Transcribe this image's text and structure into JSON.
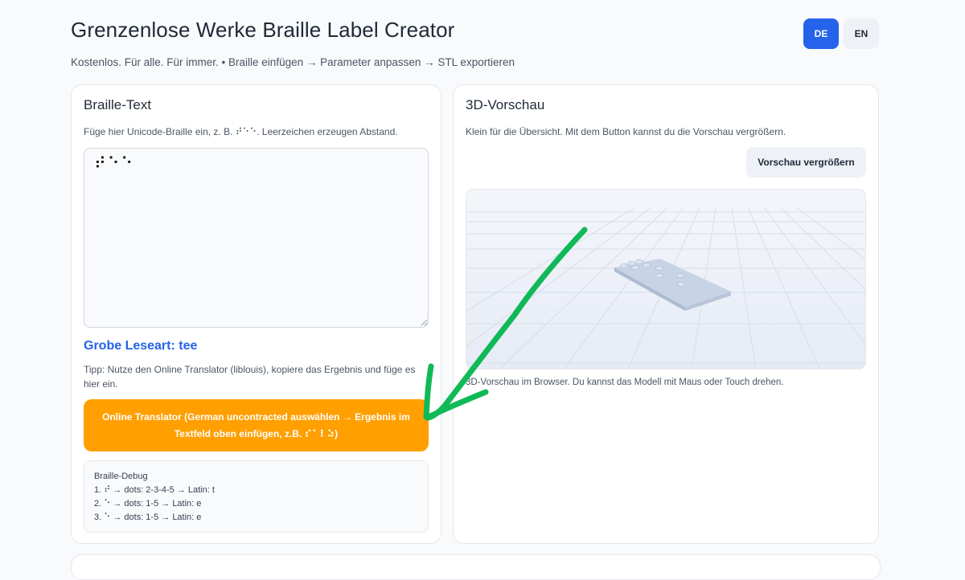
{
  "header": {
    "title": "Grenzenlose Werke Braille Label Creator",
    "subtitle": "Kostenlos. Für alle. Für immer. • Braille einfügen → Parameter anpassen → STL exportieren",
    "languages": [
      {
        "label": "DE",
        "active": true
      },
      {
        "label": "EN",
        "active": false
      }
    ]
  },
  "braille_panel": {
    "title": "Braille-Text",
    "description": "Füge hier Unicode-Braille ein, z. B. ⠞⠑⠑. Leerzeichen erzeugen Abstand.",
    "input_value": "⠞⠑⠑",
    "reading": "Grobe Leseart: tee",
    "tip": "Tipp: Nutze den Online Translator (liblouis), kopiere das Ergebnis und füge es hier ein.",
    "translator_button": "Online Translator (German uncontracted auswählen → Ergebnis im Textfeld oben einfügen, z.B. ⠎⠁⠇⠵)",
    "debug": {
      "title": "Braille-Debug",
      "lines": [
        "1. ⠞  → dots: 2-3-4-5  → Latin: t",
        "2. ⠑  → dots: 1-5  → Latin: e",
        "3. ⠑  → dots: 1-5  → Latin: e"
      ]
    }
  },
  "preview_panel": {
    "title": "3D-Vorschau",
    "description": "Klein für die Übersicht. Mit dem Button kannst du die Vorschau vergrößern.",
    "enlarge_button": "Vorschau vergrößern",
    "note": "3D-Vorschau im Browser. Du kannst das Modell mit Maus oder Touch drehen."
  },
  "colors": {
    "accent": "#2563eb",
    "translator": "#ff9f00",
    "annotation_arrow": "#10b957"
  },
  "icons": [
    "resize-grip-icon",
    "annotation-arrow-icon"
  ]
}
